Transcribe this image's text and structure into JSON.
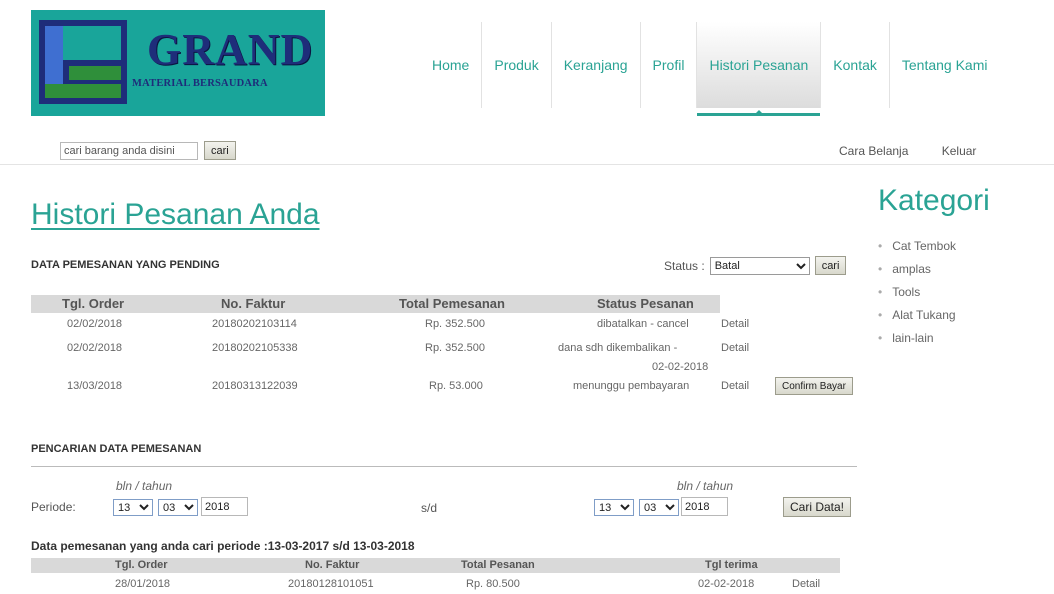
{
  "brand": {
    "title": "GRAND",
    "subtitle": "MATERIAL BERSAUDARA",
    "color": "#19a59a"
  },
  "nav": [
    {
      "label": "Home",
      "active": false
    },
    {
      "label": "Produk",
      "active": false
    },
    {
      "label": "Keranjang",
      "active": false
    },
    {
      "label": "Profil",
      "active": false
    },
    {
      "label": "Histori Pesanan",
      "active": true
    },
    {
      "label": "Kontak",
      "active": false
    },
    {
      "label": "Tentang Kami",
      "active": false
    }
  ],
  "search": {
    "placeholder": "cari barang anda disini",
    "button": "cari"
  },
  "toplinks": {
    "cara_belanja": "Cara Belanja",
    "keluar": "Keluar"
  },
  "main": {
    "title": "Histori Pesanan Anda",
    "pending": {
      "label": "DATA PEMESANAN YANG PENDING",
      "status_label": "Status :",
      "status_value": "Batal",
      "status_button": "cari",
      "headers": [
        "Tgl. Order",
        "No. Faktur",
        "Total Pemesanan",
        "Status Pesanan"
      ],
      "rows": [
        {
          "date": "02/02/2018",
          "faktur": "20180202103114",
          "total": "Rp. 352.500",
          "status": "dibatalkan - cancel",
          "status2": "",
          "detail": "Detail"
        },
        {
          "date": "02/02/2018",
          "faktur": "20180202105338",
          "total": "Rp. 352.500",
          "status": "dana sdh dikembalikan -",
          "status2": "02-02-2018",
          "detail": "Detail"
        },
        {
          "date": "13/03/2018",
          "faktur": "20180313122039",
          "total": "Rp. 53.000",
          "status": "menunggu pembayaran",
          "status2": "",
          "detail": "Detail"
        }
      ],
      "confirm_button": "Confirm Bayar"
    },
    "search_section": {
      "label": "PENCARIAN DATA PEMESANAN",
      "hint": "bln / tahun",
      "periode_label": "Periode:",
      "from": {
        "day": "13",
        "month": "03",
        "year": "2018"
      },
      "separator": "s/d",
      "to": {
        "day": "13",
        "month": "03",
        "year": "2018"
      },
      "button": "Cari Data!"
    },
    "result": {
      "title": "Data pemesanan yang anda cari periode :13-03-2017 s/d 13-03-2018",
      "headers": [
        "Tgl. Order",
        "No. Faktur",
        "Total Pesanan",
        "Tgl terima"
      ],
      "rows": [
        {
          "date": "28/01/2018",
          "faktur": "20180128101051",
          "total": "Rp. 80.500",
          "terima": "02-02-2018",
          "detail": "Detail"
        }
      ]
    }
  },
  "sidebar": {
    "title": "Kategori",
    "items": [
      "Cat Tembok",
      "amplas",
      "Tools",
      "Alat Tukang",
      "lain-lain"
    ]
  },
  "colors": {
    "accent": "#2aa394",
    "header_gray": "#d9d9d9"
  }
}
